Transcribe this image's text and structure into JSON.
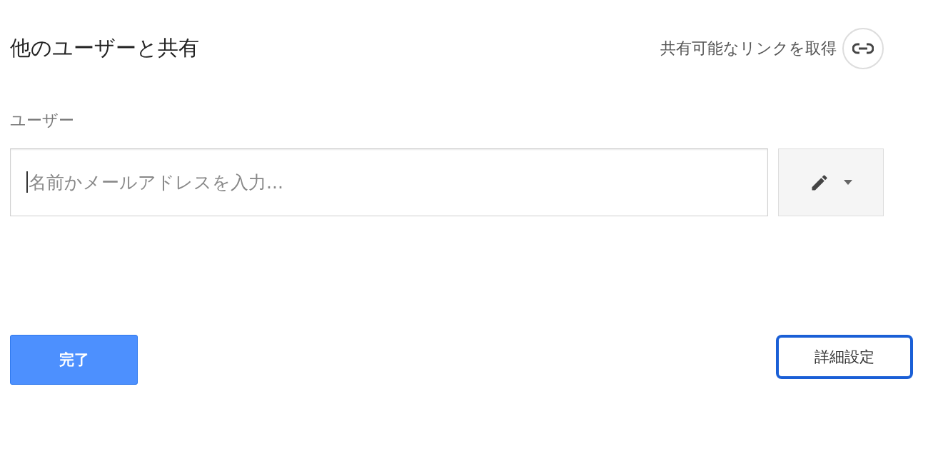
{
  "dialog": {
    "title": "他のユーザーと共有"
  },
  "share_link": {
    "label": "共有可能なリンクを取得"
  },
  "people": {
    "label": "ユーザー",
    "placeholder": "名前かメールアドレスを入力..."
  },
  "buttons": [
    {
      "kind": "primary",
      "label": "完了",
      "highlighted": false
    },
    {
      "kind": "secondary",
      "label": "詳細設定",
      "highlighted": true
    }
  ]
}
